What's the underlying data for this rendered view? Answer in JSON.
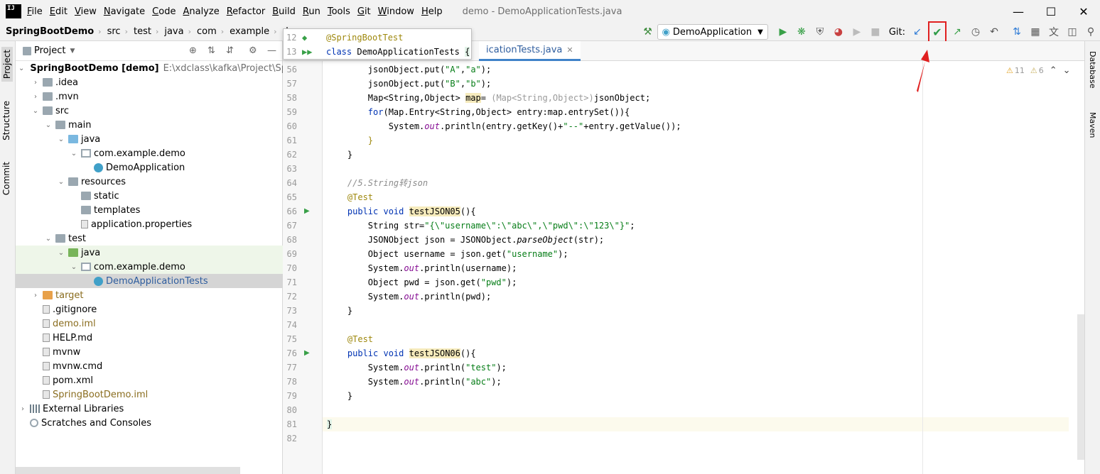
{
  "menu": {
    "items": [
      "File",
      "Edit",
      "View",
      "Navigate",
      "Code",
      "Analyze",
      "Refactor",
      "Build",
      "Run",
      "Tools",
      "Git",
      "Window",
      "Help"
    ],
    "window_title": "demo - DemoApplicationTests.java"
  },
  "breadcrumbs": [
    "SpringBootDemo",
    "src",
    "test",
    "java",
    "com",
    "example",
    "demo"
  ],
  "toolbar": {
    "run_config": "DemoApplication",
    "git_label": "Git:"
  },
  "project_panel": {
    "title": "Project",
    "root_name": "SpringBootDemo [demo]",
    "root_path": "E:\\xdclass\\kafka\\Project\\Spring",
    "tree": [
      {
        "label": ".idea",
        "indent": 2,
        "icon": "folder",
        "twist": "›"
      },
      {
        "label": ".mvn",
        "indent": 2,
        "icon": "folder",
        "twist": "›"
      },
      {
        "label": "src",
        "indent": 2,
        "icon": "folder",
        "twist": "⌄"
      },
      {
        "label": "main",
        "indent": 3,
        "icon": "folder",
        "twist": "⌄"
      },
      {
        "label": "java",
        "indent": 4,
        "icon": "folder blue",
        "twist": "⌄"
      },
      {
        "label": "com.example.demo",
        "indent": 5,
        "icon": "pkg",
        "twist": "⌄"
      },
      {
        "label": "DemoApplication",
        "indent": 6,
        "icon": "cls",
        "twist": ""
      },
      {
        "label": "resources",
        "indent": 4,
        "icon": "folder",
        "twist": "⌄"
      },
      {
        "label": "static",
        "indent": 5,
        "icon": "folder",
        "twist": ""
      },
      {
        "label": "templates",
        "indent": 5,
        "icon": "folder",
        "twist": ""
      },
      {
        "label": "application.properties",
        "indent": 5,
        "icon": "file",
        "twist": ""
      },
      {
        "label": "test",
        "indent": 3,
        "icon": "folder",
        "twist": "⌄"
      },
      {
        "label": "java",
        "indent": 4,
        "icon": "folder green",
        "twist": "⌄",
        "hl": "green"
      },
      {
        "label": "com.example.demo",
        "indent": 5,
        "icon": "pkg",
        "twist": "⌄",
        "hl": "green"
      },
      {
        "label": "DemoApplicationTests",
        "indent": 6,
        "icon": "cls",
        "twist": "",
        "hl": "sel",
        "color": "#2e5d9e"
      },
      {
        "label": "target",
        "indent": 2,
        "icon": "folder orange",
        "twist": "›",
        "color": "#8a6d1f"
      },
      {
        "label": ".gitignore",
        "indent": 2,
        "icon": "file",
        "twist": ""
      },
      {
        "label": "demo.iml",
        "indent": 2,
        "icon": "file",
        "twist": "",
        "color": "#8a6d1f"
      },
      {
        "label": "HELP.md",
        "indent": 2,
        "icon": "file",
        "twist": ""
      },
      {
        "label": "mvnw",
        "indent": 2,
        "icon": "file",
        "twist": ""
      },
      {
        "label": "mvnw.cmd",
        "indent": 2,
        "icon": "file",
        "twist": ""
      },
      {
        "label": "pom.xml",
        "indent": 2,
        "icon": "file",
        "twist": ""
      },
      {
        "label": "SpringBootDemo.iml",
        "indent": 2,
        "icon": "file",
        "twist": "",
        "color": "#8a6d1f"
      },
      {
        "label": "External Libraries",
        "indent": 1,
        "icon": "lib",
        "twist": "›"
      },
      {
        "label": "Scratches and Consoles",
        "indent": 1,
        "icon": "scratch",
        "twist": ""
      }
    ]
  },
  "left_tabs": [
    "Project",
    "Structure",
    "Commit"
  ],
  "right_tabs": [
    "Database",
    "Maven"
  ],
  "editor": {
    "tab_label": "icationTests.java",
    "warnings": "11",
    "weak_warnings": "6",
    "popup": [
      {
        "n": "12",
        "html": "<span class='ann'>@SpringBootTest</span>"
      },
      {
        "n": "13",
        "html": "<span class='kw'>class</span> DemoApplicationTests <span style='background:#e2f3e8'>{</span>"
      }
    ],
    "lines": [
      {
        "n": "56",
        "html": "        jsonObject.put(<span class='str'>\"A\"</span>,<span class='str'>\"a\"</span>);"
      },
      {
        "n": "57",
        "html": "        jsonObject.put(<span class='str'>\"B\"</span>,<span class='str'>\"b\"</span>);"
      },
      {
        "n": "58",
        "html": "        Map&lt;String,Object&gt; <span class='hl'>map</span>= <span class='gry'>(Map&lt;String,Object&gt;)</span>jsonObject;"
      },
      {
        "n": "59",
        "html": "        <span class='kw'>for</span>(Map.Entry&lt;String,Object&gt; entry:map.entrySet()){"
      },
      {
        "n": "60",
        "html": "            System.<span class='fld'>out</span>.println(entry.getKey()+<span class='str'>\"--\"</span>+entry.getValue());"
      },
      {
        "n": "61",
        "html": "        <span class='ann'>}</span>"
      },
      {
        "n": "62",
        "html": "    }"
      },
      {
        "n": "63",
        "html": ""
      },
      {
        "n": "64",
        "html": "    <span class='cm'>//5.String转json</span>"
      },
      {
        "n": "65",
        "html": "    <span class='ann'>@Test</span>"
      },
      {
        "n": "66",
        "html": "    <span class='kw'>public void</span> <span class='hl'>testJSON05</span>(){",
        "run": true
      },
      {
        "n": "67",
        "html": "        String str=<span class='str'>\"{\\\"username\\\":\\\"abc\\\",\\\"pwd\\\":\\\"123\\\"}\"</span>;"
      },
      {
        "n": "68",
        "html": "        JSONObject json = JSONObject.<span class='it'>parseObject</span>(str);"
      },
      {
        "n": "69",
        "html": "        Object username = json.get(<span class='str'>\"username\"</span>);"
      },
      {
        "n": "70",
        "html": "        System.<span class='fld'>out</span>.println(username);"
      },
      {
        "n": "71",
        "html": "        Object pwd = json.get(<span class='str'>\"pwd\"</span>);"
      },
      {
        "n": "72",
        "html": "        System.<span class='fld'>out</span>.println(pwd);"
      },
      {
        "n": "73",
        "html": "    }"
      },
      {
        "n": "74",
        "html": ""
      },
      {
        "n": "75",
        "html": "    <span class='ann'>@Test</span>"
      },
      {
        "n": "76",
        "html": "    <span class='kw'>public void</span> <span class='hl'>testJSON06</span>(){",
        "run": true
      },
      {
        "n": "77",
        "html": "        System.<span class='fld'>out</span>.println(<span class='str'>\"test\"</span>);"
      },
      {
        "n": "78",
        "html": "        System.<span class='fld'>out</span>.println(<span class='str'>\"abc\"</span>);"
      },
      {
        "n": "79",
        "html": "    }"
      },
      {
        "n": "80",
        "html": ""
      },
      {
        "n": "81",
        "html": "<span style='background:#e2f3e8'>}</span>",
        "current": true
      },
      {
        "n": "82",
        "html": ""
      }
    ]
  },
  "colors": {
    "accent": "#4083c9",
    "highlight_box": "#e02020",
    "commit_check": "#2e9c48"
  }
}
